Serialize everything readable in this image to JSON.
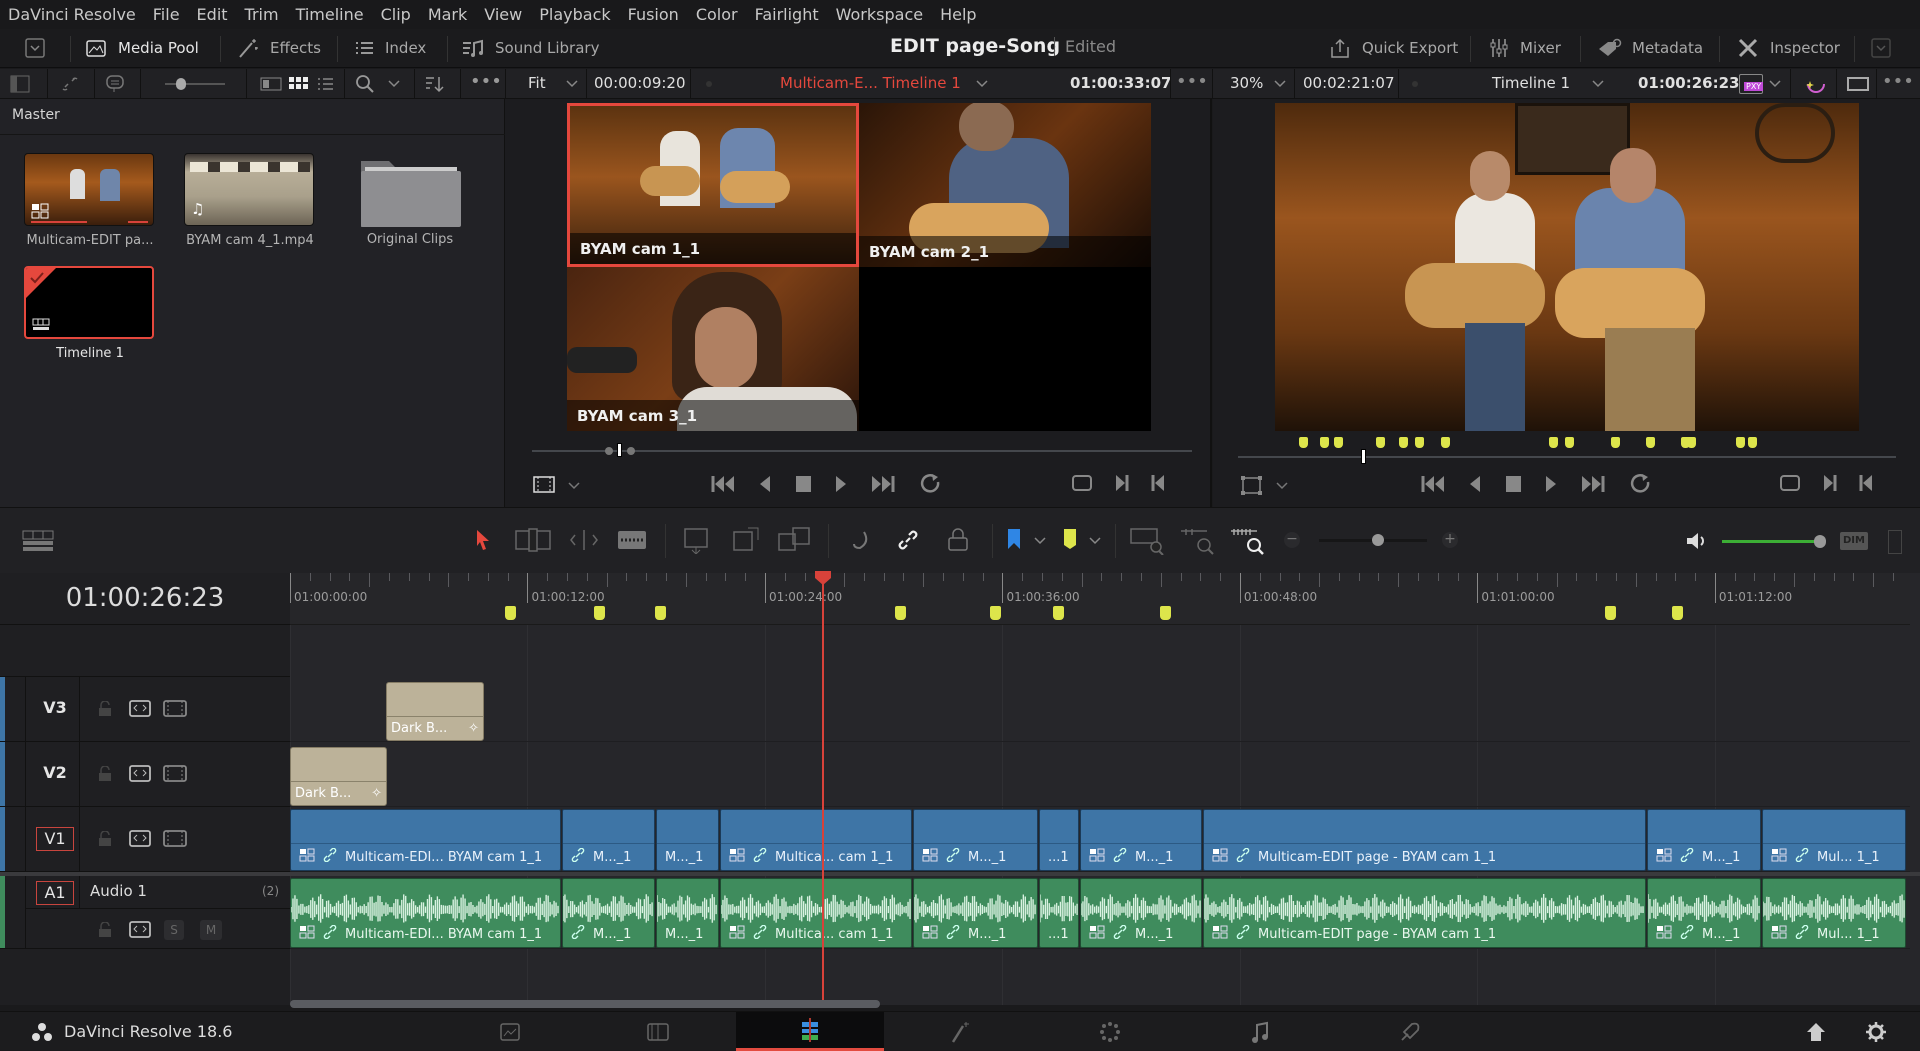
{
  "menubar": {
    "items": [
      "DaVinci Resolve",
      "File",
      "Edit",
      "Trim",
      "Timeline",
      "Clip",
      "Mark",
      "View",
      "Playback",
      "Fusion",
      "Color",
      "Fairlight",
      "Workspace",
      "Help"
    ]
  },
  "toolbar": {
    "left": [
      {
        "label": "Media Pool",
        "icon": "media-pool-icon",
        "active": true
      },
      {
        "label": "Effects",
        "icon": "magic-wand-icon",
        "active": false
      },
      {
        "label": "Index",
        "icon": "list-icon",
        "active": false
      },
      {
        "label": "Sound Library",
        "icon": "sound-library-icon",
        "active": false
      }
    ],
    "project_title": "EDIT page-Song",
    "project_status": "Edited",
    "right": [
      {
        "label": "Quick Export",
        "icon": "export-icon"
      },
      {
        "label": "Mixer",
        "icon": "mixer-icon"
      },
      {
        "label": "Metadata",
        "icon": "metadata-tag-icon"
      },
      {
        "label": "Inspector",
        "icon": "inspector-tools-icon"
      }
    ]
  },
  "source_viewer": {
    "zoom": "Fit",
    "duration": "00:00:09:20",
    "clip_title": "Multicam-E... Timeline 1",
    "timecode": "01:00:33:07",
    "angles": [
      "BYAM cam 1_1",
      "BYAM cam 2_1",
      "BYAM cam 3_1"
    ],
    "active_angle": "BYAM cam 1_1",
    "accent": "#e5483d"
  },
  "program_viewer": {
    "zoom": "30%",
    "duration": "00:02:21:07",
    "timeline_name": "Timeline 1",
    "timecode": "01:00:26:23",
    "proxy_badge": "PXY"
  },
  "media_pool": {
    "bin": "Master",
    "items": [
      {
        "name": "Multicam-EDIT pa...",
        "type": "multicam"
      },
      {
        "name": "BYAM cam 4_1.mp4",
        "type": "audio"
      },
      {
        "name": "Original Clips",
        "type": "folder"
      },
      {
        "name": "Timeline 1",
        "type": "timeline",
        "selected": true
      }
    ]
  },
  "timeline": {
    "current_timecode": "01:00:26:23",
    "ruler_labels": [
      "01:00:00:00",
      "01:00:12:00",
      "01:00:24:00",
      "01:00:36:00",
      "01:00:48:00",
      "01:01:00:00",
      "01:01:12:00"
    ],
    "tracks": [
      {
        "id": "V3",
        "clips": [
          {
            "label": "Dark B..."
          }
        ]
      },
      {
        "id": "V2",
        "clips": [
          {
            "label": "Dark B..."
          }
        ]
      },
      {
        "id": "V1",
        "clips": [
          {
            "label": "Multicam-EDI... BYAM cam 1_1"
          },
          {
            "label": "M..._1"
          },
          {
            "label": "M..._1"
          },
          {
            "label": "Multica... cam 1_1"
          },
          {
            "label": "M..._1"
          },
          {
            "label": "...1"
          },
          {
            "label": "M..._1"
          },
          {
            "label": "Multicam-EDIT page - BYAM cam 1_1"
          },
          {
            "label": "M..._1"
          },
          {
            "label": "Mul... 1_1"
          }
        ]
      },
      {
        "id": "A1",
        "name": "Audio 1",
        "channels": "(2)",
        "solo": "S",
        "mute": "M",
        "clips": [
          {
            "label": "Multicam-EDI... BYAM cam 1_1"
          },
          {
            "label": "M..._1"
          },
          {
            "label": "M..._1"
          },
          {
            "label": "Multica... cam 1_1"
          },
          {
            "label": "M..._1"
          },
          {
            "label": "...1"
          },
          {
            "label": "M..._1"
          },
          {
            "label": "Multicam-EDIT page - BYAM cam 1_1"
          },
          {
            "label": "M..._1"
          },
          {
            "label": "Mul... 1_1"
          }
        ]
      }
    ],
    "dim_label": "DIM"
  },
  "bottombar": {
    "app_name": "DaVinci Resolve 18.6",
    "pages": [
      "Media",
      "Cut",
      "Edit",
      "Fusion",
      "Color",
      "Fairlight",
      "Deliver"
    ],
    "active_page": "Edit"
  },
  "colors": {
    "marker": "#dde54b",
    "playhead": "#d8423a",
    "video_clip": "#3e75a6",
    "audio_clip": "#3f8c5d",
    "title_clip": "#bcb299"
  }
}
